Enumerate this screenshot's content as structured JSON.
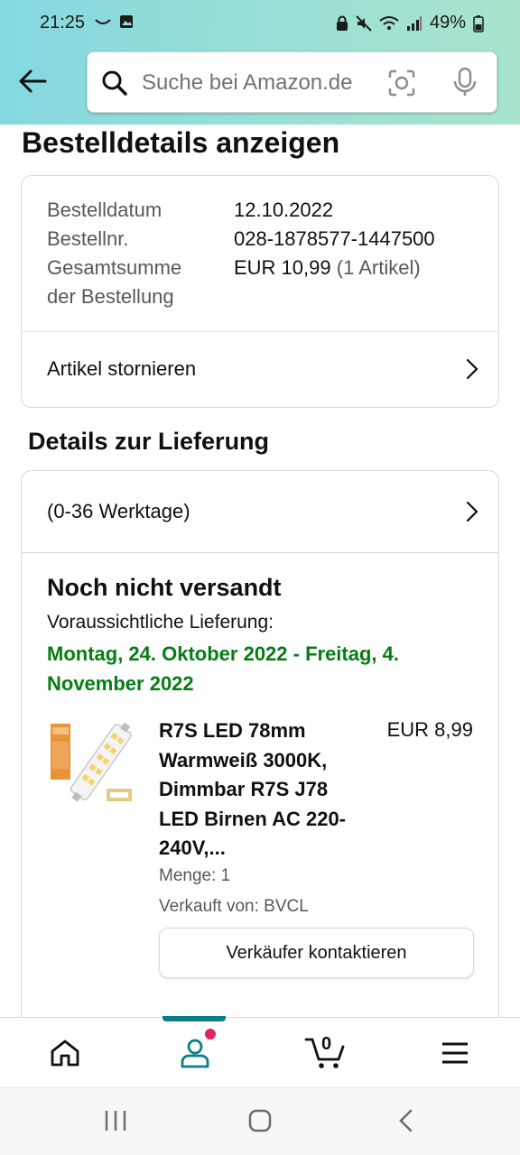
{
  "status_bar": {
    "time": "21:25",
    "battery": "49%"
  },
  "search": {
    "placeholder": "Suche bei Amazon.de"
  },
  "page": {
    "title": "Bestelldetails anzeigen"
  },
  "order_summary": {
    "rows": [
      {
        "label": "Bestelldatum",
        "value": "12.10.2022"
      },
      {
        "label": "Bestellnr.",
        "value": "028-1878577-1447500"
      },
      {
        "label": "Gesamtsumme der Bestellung",
        "value": "EUR 10,99",
        "extra": "(1 Artikel)"
      }
    ],
    "cancel_link": "Artikel stornieren"
  },
  "delivery": {
    "section_title": "Details zur Lieferung",
    "timeframe": "(0-36 Werktage)",
    "status": "Noch nicht versandt",
    "expected_label": "Voraussichtliche Lieferung:",
    "expected_date": "Montag, 24. Oktober 2022 - Freitag, 4. November 2022"
  },
  "product": {
    "title": "R7S LED 78mm Warmweiß 3000K, Dimmbar R7S J78 LED Birnen AC 220-240V,...",
    "price": "EUR 8,99",
    "quantity": "Menge: 1",
    "seller": "Verkauft von: BVCL",
    "contact_button": "Verkäufer kontaktieren"
  },
  "bottom_nav": {
    "items": [
      "home-icon",
      "account-icon",
      "cart-icon",
      "menu-icon"
    ],
    "active": "account-icon",
    "cart_count": "0"
  },
  "colors": {
    "accent": "#0a7d8a",
    "delivery_green": "#067d12",
    "notification_dot": "#e0245e",
    "header_gradient_start": "#84d8e0",
    "header_gradient_end": "#a8e4cc"
  }
}
